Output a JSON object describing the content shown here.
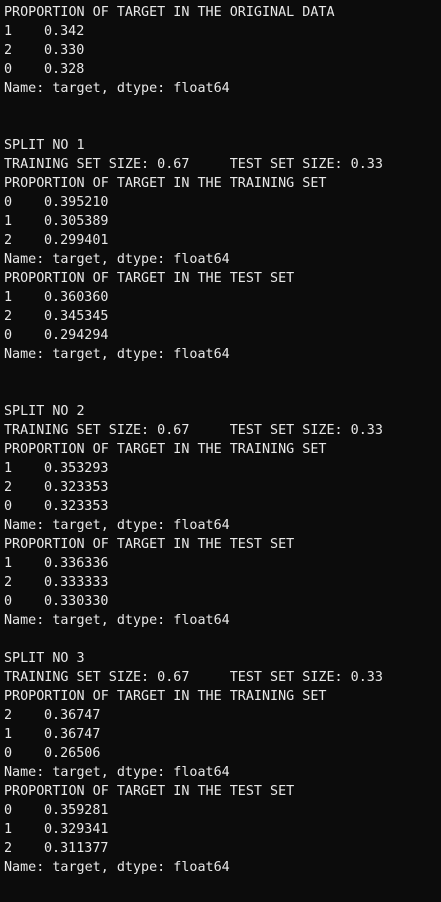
{
  "original": {
    "header": "PROPORTION OF TARGET IN THE ORIGINAL DATA",
    "rows": [
      {
        "label": "1",
        "value": "0.342"
      },
      {
        "label": "2",
        "value": "0.330"
      },
      {
        "label": "0",
        "value": "0.328"
      }
    ],
    "footer": "Name: target, dtype: float64"
  },
  "splits": [
    {
      "title": "SPLIT NO 1",
      "sizes": "TRAINING SET SIZE: 0.67     TEST SET SIZE: 0.33",
      "train_header": "PROPORTION OF TARGET IN THE TRAINING SET",
      "train_rows": [
        {
          "label": "0",
          "value": "0.395210"
        },
        {
          "label": "1",
          "value": "0.305389"
        },
        {
          "label": "2",
          "value": "0.299401"
        }
      ],
      "train_footer": "Name: target, dtype: float64",
      "test_header": "PROPORTION OF TARGET IN THE TEST SET",
      "test_rows": [
        {
          "label": "1",
          "value": "0.360360"
        },
        {
          "label": "2",
          "value": "0.345345"
        },
        {
          "label": "0",
          "value": "0.294294"
        }
      ],
      "test_footer": "Name: target, dtype: float64"
    },
    {
      "title": "SPLIT NO 2",
      "sizes": "TRAINING SET SIZE: 0.67     TEST SET SIZE: 0.33",
      "train_header": "PROPORTION OF TARGET IN THE TRAINING SET",
      "train_rows": [
        {
          "label": "1",
          "value": "0.353293"
        },
        {
          "label": "2",
          "value": "0.323353"
        },
        {
          "label": "0",
          "value": "0.323353"
        }
      ],
      "train_footer": "Name: target, dtype: float64",
      "test_header": "PROPORTION OF TARGET IN THE TEST SET",
      "test_rows": [
        {
          "label": "1",
          "value": "0.336336"
        },
        {
          "label": "2",
          "value": "0.333333"
        },
        {
          "label": "0",
          "value": "0.330330"
        }
      ],
      "test_footer": "Name: target, dtype: float64"
    },
    {
      "title": "SPLIT NO 3",
      "sizes": "TRAINING SET SIZE: 0.67     TEST SET SIZE: 0.33",
      "train_header": "PROPORTION OF TARGET IN THE TRAINING SET",
      "train_rows": [
        {
          "label": "2",
          "value": "0.36747"
        },
        {
          "label": "1",
          "value": "0.36747"
        },
        {
          "label": "0",
          "value": "0.26506"
        }
      ],
      "train_footer": "Name: target, dtype: float64",
      "test_header": "PROPORTION OF TARGET IN THE TEST SET",
      "test_rows": [
        {
          "label": "0",
          "value": "0.359281"
        },
        {
          "label": "1",
          "value": "0.329341"
        },
        {
          "label": "2",
          "value": "0.311377"
        }
      ],
      "test_footer": "Name: target, dtype: float64"
    }
  ]
}
